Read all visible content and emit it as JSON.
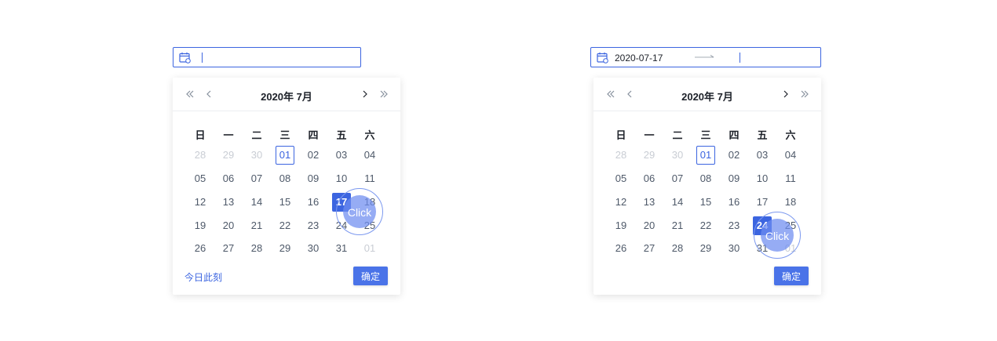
{
  "colors": {
    "accent": "#3c65e0",
    "button": "#4a73e8",
    "muted": "#c9cdd4",
    "text": "#4e5969"
  },
  "left_picker": {
    "input": {
      "value": "",
      "icon": "calendar-icon"
    },
    "panel": {
      "title": "2020年 7月",
      "weekdays": [
        "日",
        "一",
        "二",
        "三",
        "四",
        "五",
        "六"
      ],
      "weeks": [
        [
          "28",
          "29",
          "30",
          "01",
          "02",
          "03",
          "04"
        ],
        [
          "05",
          "06",
          "07",
          "08",
          "09",
          "10",
          "11"
        ],
        [
          "12",
          "13",
          "14",
          "15",
          "16",
          "17",
          "18"
        ],
        [
          "19",
          "20",
          "21",
          "22",
          "23",
          "24",
          "25"
        ],
        [
          "26",
          "27",
          "28",
          "29",
          "30",
          "31",
          "01"
        ]
      ],
      "today_link": "今日此刻",
      "confirm_label": "确定",
      "click_label": "Click"
    }
  },
  "right_picker": {
    "input": {
      "start_value": "2020-07-17",
      "end_value": "",
      "icon": "calendar-icon"
    },
    "panel": {
      "title": "2020年 7月",
      "weekdays": [
        "日",
        "一",
        "二",
        "三",
        "四",
        "五",
        "六"
      ],
      "weeks": [
        [
          "28",
          "29",
          "30",
          "01",
          "02",
          "03",
          "04"
        ],
        [
          "05",
          "06",
          "07",
          "08",
          "09",
          "10",
          "11"
        ],
        [
          "12",
          "13",
          "14",
          "15",
          "16",
          "17",
          "18"
        ],
        [
          "19",
          "20",
          "21",
          "22",
          "23",
          "24",
          "25"
        ],
        [
          "26",
          "27",
          "28",
          "29",
          "30",
          "31",
          "01"
        ]
      ],
      "confirm_label": "确定",
      "click_label": "Click"
    }
  }
}
